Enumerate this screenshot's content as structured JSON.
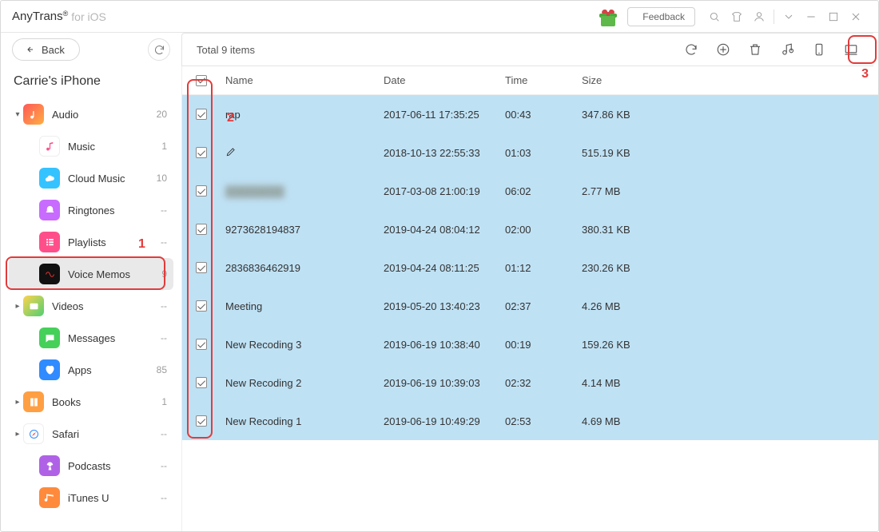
{
  "app": {
    "name": "AnyTrans",
    "reg": "®",
    "sub": "for iOS",
    "feedback": "Feedback"
  },
  "back_label": "Back",
  "device_name": "Carrie's iPhone",
  "total_text": "Total 9 items",
  "columns": {
    "name": "Name",
    "date": "Date",
    "time": "Time",
    "size": "Size"
  },
  "sidebar": [
    {
      "kind": "group",
      "icon": "audio",
      "label": "Audio",
      "count": "20",
      "expanded": true
    },
    {
      "kind": "child",
      "icon": "music",
      "label": "Music",
      "count": "1"
    },
    {
      "kind": "child",
      "icon": "cloud",
      "label": "Cloud Music",
      "count": "10"
    },
    {
      "kind": "child",
      "icon": "ring",
      "label": "Ringtones",
      "count": "--"
    },
    {
      "kind": "child",
      "icon": "play",
      "label": "Playlists",
      "count": "--"
    },
    {
      "kind": "child",
      "icon": "voice",
      "label": "Voice Memos",
      "count": "9",
      "selected": true
    },
    {
      "kind": "group",
      "icon": "video",
      "label": "Videos",
      "count": "--"
    },
    {
      "kind": "child",
      "icon": "msg",
      "label": "Messages",
      "count": "--"
    },
    {
      "kind": "child",
      "icon": "apps",
      "label": "Apps",
      "count": "85"
    },
    {
      "kind": "group",
      "icon": "books",
      "label": "Books",
      "count": "1"
    },
    {
      "kind": "group",
      "icon": "safari",
      "label": "Safari",
      "count": "--"
    },
    {
      "kind": "child",
      "icon": "pod",
      "label": "Podcasts",
      "count": "--"
    },
    {
      "kind": "child",
      "icon": "itu",
      "label": "iTunes U",
      "count": "--"
    }
  ],
  "rows": [
    {
      "name": "rap",
      "date": "2017-06-11 17:35:25",
      "time": "00:43",
      "size": "347.86 KB"
    },
    {
      "name": "",
      "date": "2018-10-13 22:55:33",
      "time": "01:03",
      "size": "515.19 KB",
      "pencil": true
    },
    {
      "name": "████████",
      "date": "2017-03-08 21:00:19",
      "time": "06:02",
      "size": "2.77 MB",
      "blur": true
    },
    {
      "name": "9273628194837",
      "date": "2019-04-24 08:04:12",
      "time": "02:00",
      "size": "380.31 KB"
    },
    {
      "name": "2836836462919",
      "date": "2019-04-24 08:11:25",
      "time": "01:12",
      "size": "230.26 KB"
    },
    {
      "name": "Meeting",
      "date": "2019-05-20 13:40:23",
      "time": "02:37",
      "size": "4.26 MB"
    },
    {
      "name": "New Recoding 3",
      "date": "2019-06-19 10:38:40",
      "time": "00:19",
      "size": "159.26 KB"
    },
    {
      "name": "New Recoding 2",
      "date": "2019-06-19 10:39:03",
      "time": "02:32",
      "size": "4.14 MB"
    },
    {
      "name": "New Recoding 1",
      "date": "2019-06-19 10:49:29",
      "time": "02:53",
      "size": "4.69 MB"
    }
  ],
  "annotations": {
    "one": "1",
    "two": "2",
    "three": "3"
  }
}
